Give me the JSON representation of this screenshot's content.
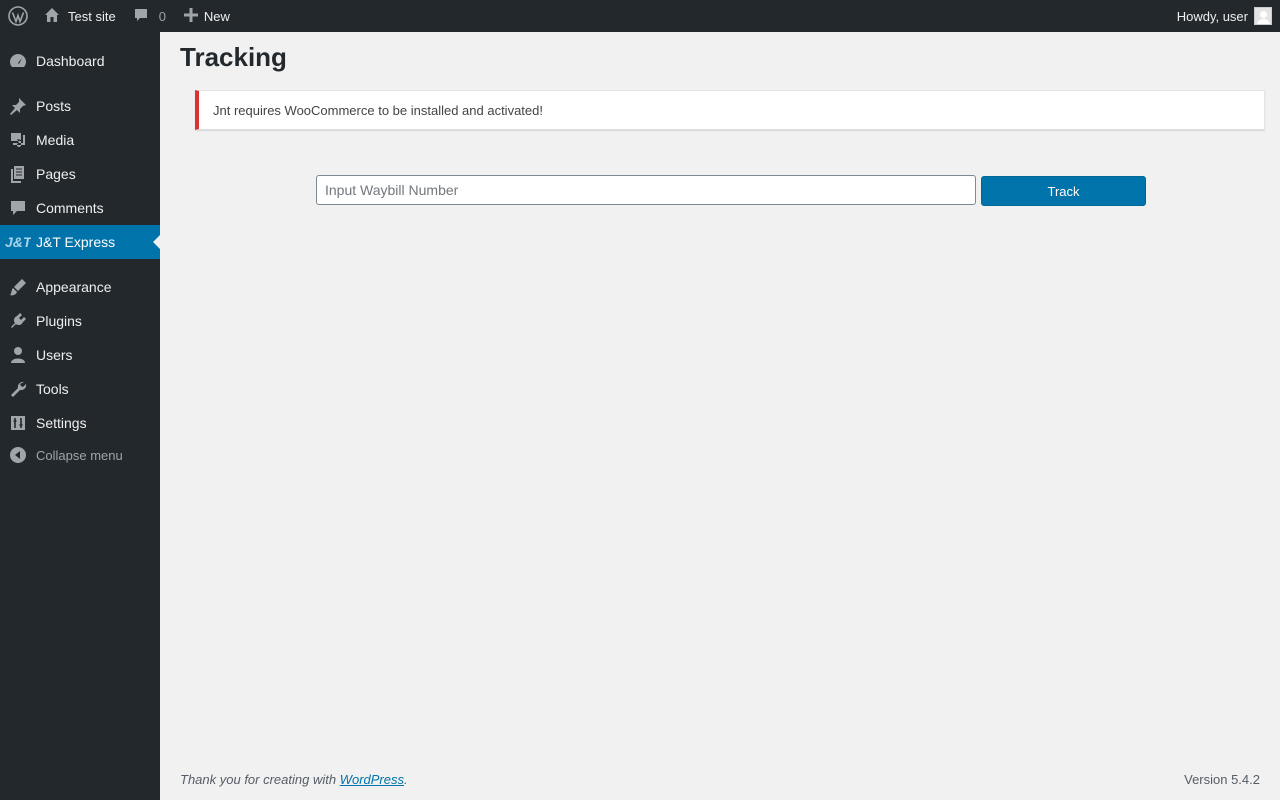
{
  "adminbar": {
    "wp_logo": "wordpress-logo-icon",
    "site_name": "Test site",
    "comments_count": "0",
    "new_label": "New",
    "greeting": "Howdy, user"
  },
  "sidebar": {
    "items": [
      {
        "label": "Dashboard",
        "icon": "dashboard-icon"
      },
      {
        "label": "Posts",
        "icon": "pin-icon"
      },
      {
        "label": "Media",
        "icon": "media-icon"
      },
      {
        "label": "Pages",
        "icon": "pages-icon"
      },
      {
        "label": "Comments",
        "icon": "comment-icon"
      },
      {
        "label": "J&T Express",
        "icon": "jt-logo-icon",
        "current": true
      },
      {
        "label": "Appearance",
        "icon": "brush-icon"
      },
      {
        "label": "Plugins",
        "icon": "plug-icon"
      },
      {
        "label": "Users",
        "icon": "user-icon"
      },
      {
        "label": "Tools",
        "icon": "wrench-icon"
      },
      {
        "label": "Settings",
        "icon": "settings-icon"
      }
    ],
    "collapse_label": "Collapse menu"
  },
  "main": {
    "title": "Tracking",
    "notice": "Jnt requires WooCommerce to be installed and activated!",
    "waybill_placeholder": "Input Waybill Number",
    "waybill_value": "",
    "track_label": "Track"
  },
  "footer": {
    "thanks_prefix": "Thank you for creating with ",
    "thanks_link": "WordPress",
    "thanks_suffix": ".",
    "version": "Version 5.4.2"
  },
  "colors": {
    "adminbar_bg": "#23282d",
    "accent": "#0073aa",
    "notice_error": "#dc3232",
    "page_bg": "#f1f1f1"
  }
}
